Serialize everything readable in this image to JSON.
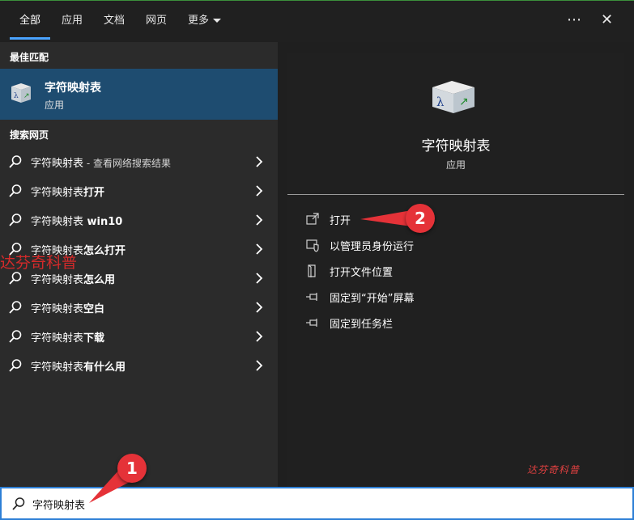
{
  "tabs": [
    {
      "label": "全部"
    },
    {
      "label": "应用"
    },
    {
      "label": "文档"
    },
    {
      "label": "网页"
    },
    {
      "label": "更多"
    }
  ],
  "top_icons": {
    "more": "⋯",
    "close": "✕"
  },
  "best_match": {
    "section_title": "最佳匹配",
    "name": "字符映射表",
    "subtitle": "应用"
  },
  "web": {
    "section_title": "搜索网页",
    "items": [
      {
        "base": "字符映射表",
        "suffix": "",
        "dim": " - 查看网络搜索结果"
      },
      {
        "base": "字符映射表",
        "suffix": "打开",
        "dim": ""
      },
      {
        "base": "字符映射表",
        "suffix": " win10",
        "dim": ""
      },
      {
        "base": "字符映射表",
        "suffix": "怎么打开",
        "dim": ""
      },
      {
        "base": "字符映射表",
        "suffix": "怎么用",
        "dim": ""
      },
      {
        "base": "字符映射表",
        "suffix": "空白",
        "dim": ""
      },
      {
        "base": "字符映射表",
        "suffix": "下载",
        "dim": ""
      },
      {
        "base": "字符映射表",
        "suffix": "有什么用",
        "dim": ""
      }
    ]
  },
  "watermark_left": "达芬奇科普",
  "watermark_right": "达芬奇科普",
  "detail": {
    "title": "字符映射表",
    "subtitle": "应用",
    "actions": [
      {
        "label": "打开",
        "icon": "open-icon"
      },
      {
        "label": "以管理员身份运行",
        "icon": "shield-icon"
      },
      {
        "label": "打开文件位置",
        "icon": "file-location-icon"
      },
      {
        "label": "固定到“开始”屏幕",
        "icon": "pin-icon"
      },
      {
        "label": "固定到任务栏",
        "icon": "pin-icon"
      }
    ]
  },
  "search": {
    "value": "字符映射表"
  },
  "annotations": {
    "badge1": "1",
    "badge2": "2"
  },
  "colors": {
    "accent": "#4aa3ff",
    "selected": "#1e4c70",
    "annotation": "#e53238"
  }
}
